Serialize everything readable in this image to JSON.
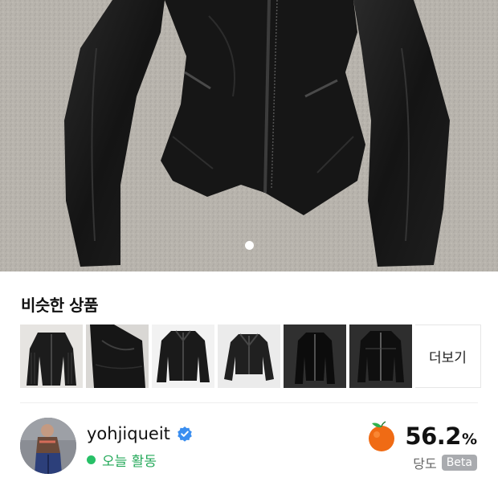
{
  "hero": {
    "image_alt": "black leather jacket",
    "carousel_dots": 2,
    "active_dot": 0
  },
  "similar": {
    "title": "비슷한 상품",
    "items": [
      {
        "alt": "quilted leather biker jacket"
      },
      {
        "alt": "leather jacket back view"
      },
      {
        "alt": "black leather jacket"
      },
      {
        "alt": "cropped leather jacket"
      },
      {
        "alt": "dark leather jacket"
      },
      {
        "alt": "leather jacket on dark background"
      }
    ],
    "more_label": "더보기"
  },
  "seller": {
    "name": "yohjiqueit",
    "verified": true,
    "activity": "오늘 활동",
    "temperature_value": "56.2",
    "temperature_unit": "%",
    "temperature_label": "당도",
    "badge": "Beta",
    "accent_color": "#f06b14",
    "active_color": "#27c067"
  }
}
